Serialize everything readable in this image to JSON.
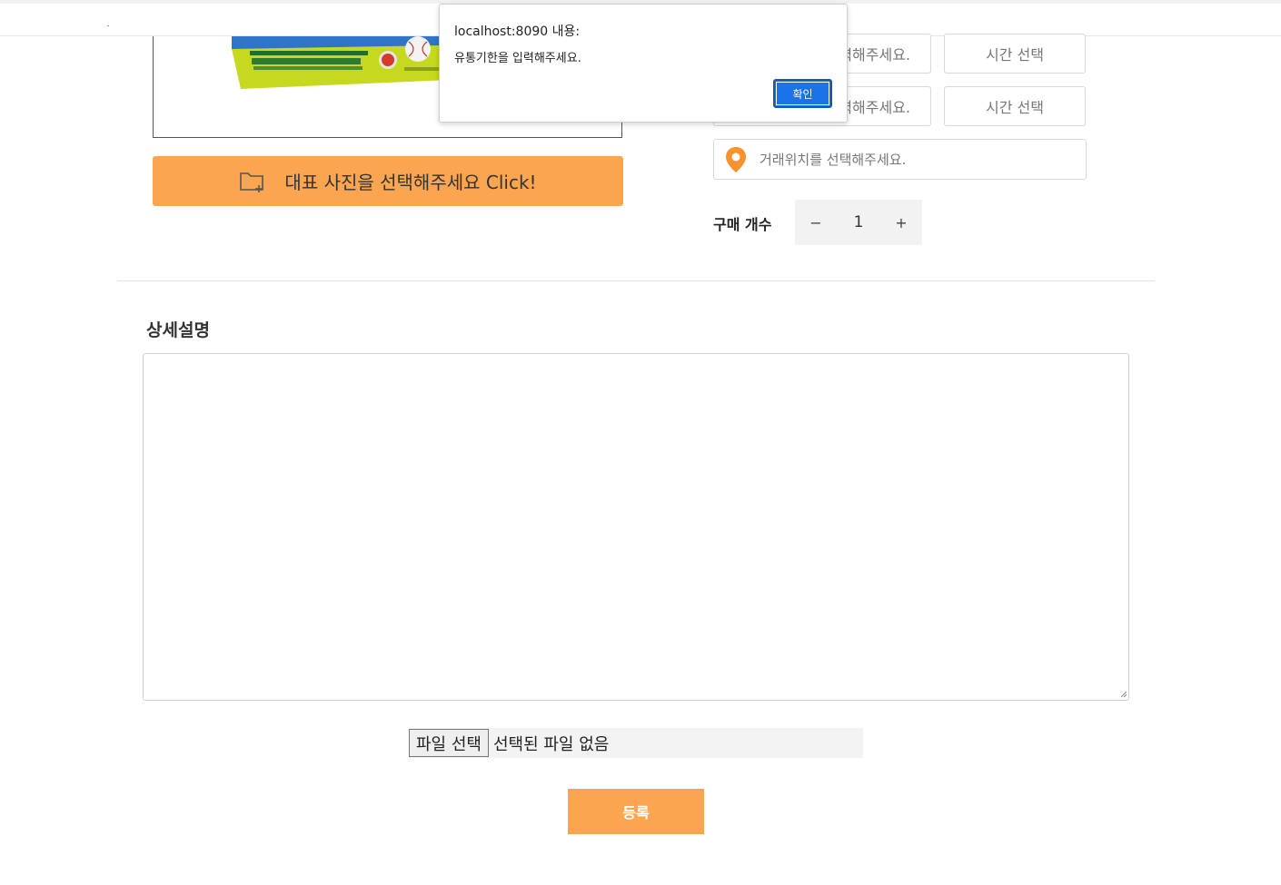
{
  "dialog": {
    "title": "localhost:8090 내용:",
    "message": "유통기한을 입력해주세요.",
    "ok_label": "확인",
    "ok_color": "#1a73e8"
  },
  "photo": {
    "button_label": "대표 사진을 선택해주세요 Click!",
    "button_icon": "folder-plus-icon",
    "accent_color": "#fca550"
  },
  "schedule": {
    "rows": [
      {
        "date_placeholder": "력해주세요.",
        "time_label": "시간 선택"
      },
      {
        "date_placeholder": "력해주세요.",
        "time_label": "시간 선택"
      }
    ],
    "location_placeholder": "거래위치를 선택해주세요.",
    "location_icon": "map-pin-icon"
  },
  "quantity": {
    "label": "구매 개수",
    "minus": "−",
    "value": "1",
    "plus": "+"
  },
  "detail": {
    "title": "상세설명",
    "text": ""
  },
  "file": {
    "button_label": "파일 선택",
    "status": "선택된 파일 없음"
  },
  "submit": {
    "label": "등록"
  }
}
